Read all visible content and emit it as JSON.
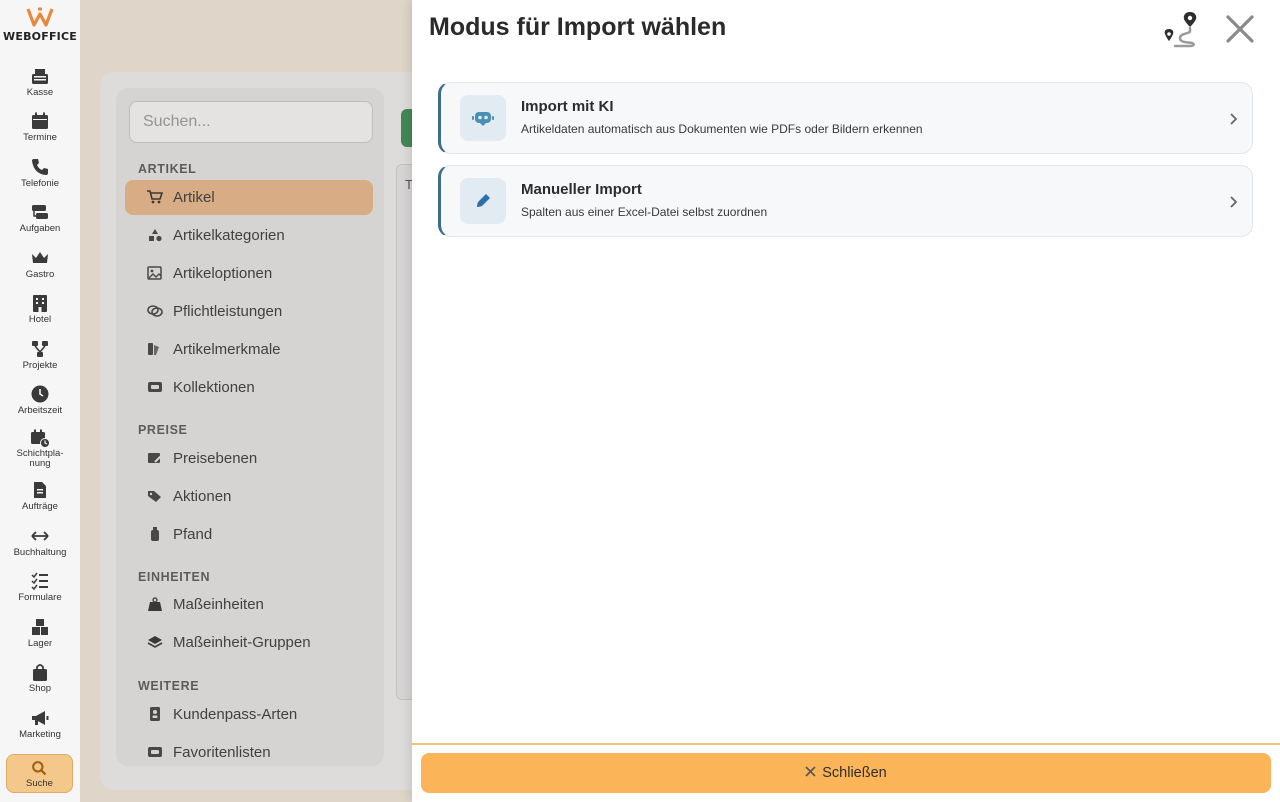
{
  "brand": {
    "name": "WEBOFFICE",
    "accent": "#e9883a"
  },
  "rail": {
    "items": [
      {
        "label": "Kasse",
        "icon": "cash-register-icon"
      },
      {
        "label": "Termine",
        "icon": "calendar-icon"
      },
      {
        "label": "Telefonie",
        "icon": "phone-icon"
      },
      {
        "label": "Aufgaben",
        "icon": "tasks-icon"
      },
      {
        "label": "Gastro",
        "icon": "crown-icon"
      },
      {
        "label": "Hotel",
        "icon": "building-icon"
      },
      {
        "label": "Projekte",
        "icon": "project-icon"
      },
      {
        "label": "Arbeitszeit",
        "icon": "clock-icon"
      },
      {
        "label_line1": "Schichtpla-",
        "label_line2": "nung",
        "icon": "shift-calendar-icon"
      },
      {
        "label": "Aufträge",
        "icon": "document-icon"
      },
      {
        "label": "Buchhaltung",
        "icon": "arrows-icon"
      },
      {
        "label": "Formulare",
        "icon": "checklist-icon"
      },
      {
        "label": "Lager",
        "icon": "boxes-icon"
      },
      {
        "label": "Shop",
        "icon": "bag-icon"
      },
      {
        "label": "Marketing",
        "icon": "megaphone-icon"
      },
      {
        "label": "Suche",
        "icon": "search-icon"
      }
    ]
  },
  "sidebar": {
    "search_placeholder": "Suchen...",
    "sections": [
      {
        "title": "ARTIKEL",
        "items": [
          "Artikel",
          "Artikelkategorien",
          "Artikeloptionen",
          "Pflichtleistungen",
          "Artikelmerkmale",
          "Kollektionen"
        ]
      },
      {
        "title": "PREISE",
        "items": [
          "Preisebenen",
          "Aktionen",
          "Pfand"
        ]
      },
      {
        "title": "EINHEITEN",
        "items": [
          "Maßeinheiten",
          "Maßeinheit-Gruppen"
        ]
      },
      {
        "title": "WEITERE",
        "items": [
          "Kundenpass-Arten",
          "Favoritenlisten"
        ]
      }
    ],
    "table_header_partial": "T"
  },
  "drawer": {
    "title": "Modus für Import wählen",
    "options": [
      {
        "title": "Import mit KI",
        "subtitle": "Artikeldaten automatisch aus Dokumenten wie PDFs oder Bildern erkennen",
        "icon": "robot-icon"
      },
      {
        "title": "Manueller Import",
        "subtitle": "Spalten aus einer Excel-Datei selbst zuordnen",
        "icon": "pencil-icon"
      }
    ],
    "close_label": "Schließen"
  }
}
